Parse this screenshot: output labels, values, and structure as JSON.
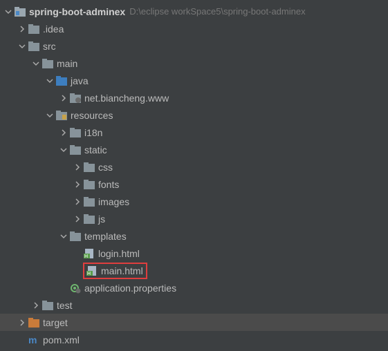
{
  "project": {
    "name": "spring-boot-adminex",
    "path": "D:\\eclipse workSpace5\\spring-boot-adminex"
  },
  "nodes": {
    "idea": ".idea",
    "src": "src",
    "main": "main",
    "java": "java",
    "pkg": "net.biancheng.www",
    "resources": "resources",
    "i18n": "i18n",
    "static": "static",
    "css": "css",
    "fonts": "fonts",
    "images": "images",
    "js": "js",
    "templates": "templates",
    "login": "login.html",
    "mainhtml": "main.html",
    "appprops": "application.properties",
    "test": "test",
    "target": "target",
    "pom": "pom.xml"
  }
}
